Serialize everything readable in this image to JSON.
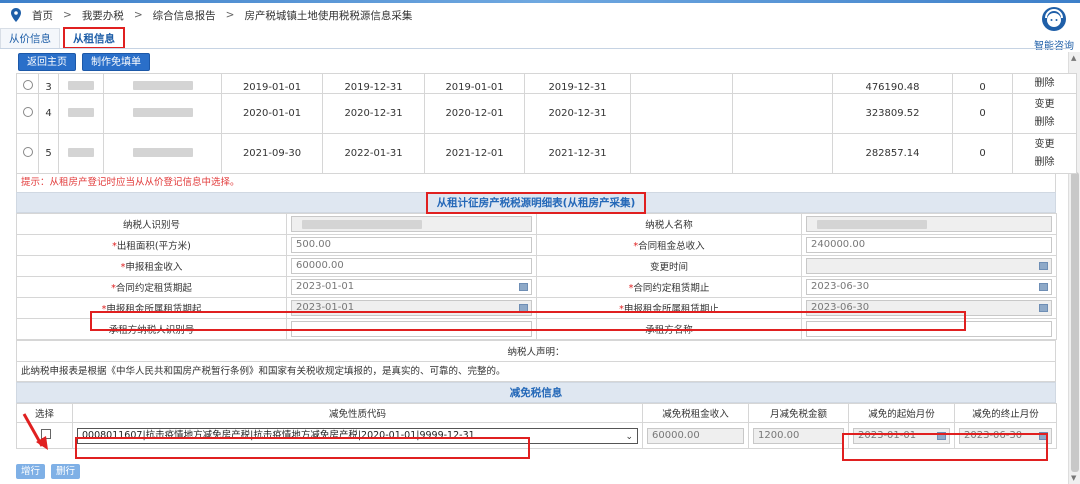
{
  "breadcrumb": [
    "首页",
    "我要办税",
    "综合信息报告",
    "房产税城镇土地使用税税源信息采集"
  ],
  "help": {
    "label": "智能咨询"
  },
  "tabs": [
    {
      "label": "从价信息",
      "active": false
    },
    {
      "label": "从租信息",
      "active": true
    }
  ],
  "buttons": {
    "back": "返回主页",
    "make": "制作免填单"
  },
  "lease_rows": [
    {
      "no": "3",
      "d1": "2019-01-01",
      "d2": "2019-12-31",
      "d3": "2019-01-01",
      "d4": "2019-12-31",
      "amount": "476190.48",
      "zero": "0",
      "ops": [
        "删除"
      ]
    },
    {
      "no": "4",
      "d1": "2020-01-01",
      "d2": "2020-12-31",
      "d3": "2020-12-01",
      "d4": "2020-12-31",
      "amount": "323809.52",
      "zero": "0",
      "ops": [
        "变更",
        "删除"
      ]
    },
    {
      "no": "5",
      "d1": "2021-09-30",
      "d2": "2022-01-31",
      "d3": "2021-12-01",
      "d4": "2021-12-31",
      "amount": "282857.14",
      "zero": "0",
      "ops": [
        "变更",
        "删除"
      ]
    }
  ],
  "hint": "提示：从租房产登记时应当从从价登记信息中选择。",
  "detail": {
    "title": "从租计征房产税税源明细表(从租房产采集)",
    "taxpayer_id_label": "纳税人识别号",
    "taxpayer_name_label": "纳税人名称",
    "area_label": "出租面积(平方米)",
    "area_value": "500.00",
    "total_income_label": "合同租金总收入",
    "total_income_value": "240000.00",
    "declared_income_label": "申报租金收入",
    "declared_income_value": "60000.00",
    "change_time_label": "变更时间",
    "contract_start_label": "合同约定租赁期起",
    "contract_start_value": "2023-01-01",
    "contract_end_label": "合同约定租赁期止",
    "contract_end_value": "2023-06-30",
    "period_start_label": "申报租金所属租赁期起",
    "period_start_value": "2023-01-01",
    "period_end_label": "申报租金所属租赁期止",
    "period_end_value": "2023-06-30",
    "lessee_id_label": "承租方纳税人识别号",
    "lessee_name_label": "承租方名称"
  },
  "declaration": {
    "label": "纳税人声明：",
    "statement": "此纳税申报表是根据《中华人民共和国房产税暂行条例》和国家有关税收规定填报的，是真实的、可靠的、完整的。"
  },
  "exemption": {
    "title": "减免税信息",
    "headers": [
      "选择",
      "减免性质代码",
      "减免税租金收入",
      "月减免税金额",
      "减免的起始月份",
      "减免的终止月份"
    ],
    "code": "0008011607|抗击疫情地方减免房产税|抗击疫情地方减免房产税|2020-01-01|9999-12-31",
    "income": "60000.00",
    "monthly": "1200.00",
    "start": "2023-01-01",
    "end": "2023-06-30"
  },
  "row_buttons": {
    "add": "增行",
    "delete": "删行"
  }
}
